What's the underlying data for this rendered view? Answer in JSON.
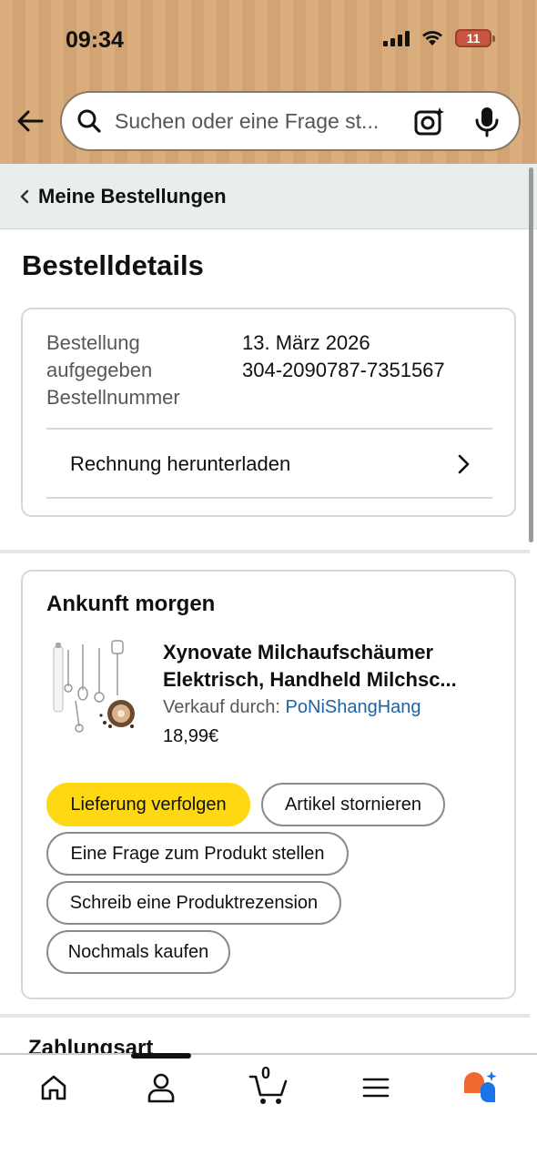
{
  "status_bar": {
    "time": "09:34",
    "battery_level": "11",
    "icons": [
      "signal-icon",
      "wifi-icon",
      "battery-icon"
    ]
  },
  "search": {
    "placeholder": "Suchen oder eine Frage st..."
  },
  "breadcrumb": {
    "label": "Meine Bestellungen"
  },
  "page": {
    "title": "Bestelldetails"
  },
  "order_info": {
    "placed_label_line1": "Bestellung",
    "placed_label_line2": "aufgegeben",
    "number_label": "Bestellnummer",
    "placed_date": "13. März 2026",
    "order_number": "304-2090787-7351567",
    "invoice_link": "Rechnung herunterladen"
  },
  "delivery": {
    "title": "Ankunft morgen",
    "product_title_line1": "Xynovate Milchaufschäumer",
    "product_title_line2": "Elektrisch, Handheld Milchsc...",
    "seller_prefix": "Verkauf durch:",
    "seller_name": "PoNiShangHang",
    "price": "18,99€",
    "actions": {
      "track": "Lieferung verfolgen",
      "cancel": "Artikel stornieren",
      "question": "Eine Frage zum Produkt stellen",
      "review": "Schreib eine Produktrezension",
      "rebuy": "Nochmals kaufen"
    }
  },
  "payment_section_title": "Zahlungsart",
  "tabbar": {
    "cart_count": "0",
    "tabs": [
      "home-icon",
      "account-icon",
      "cart-icon",
      "menu-icon",
      "rufus-assistant-icon"
    ]
  },
  "colors": {
    "header_bg": "#d9ad7c",
    "primary_button": "#ffd814",
    "link": "#2162a1",
    "breadcrumb_bg": "#eaeded"
  }
}
